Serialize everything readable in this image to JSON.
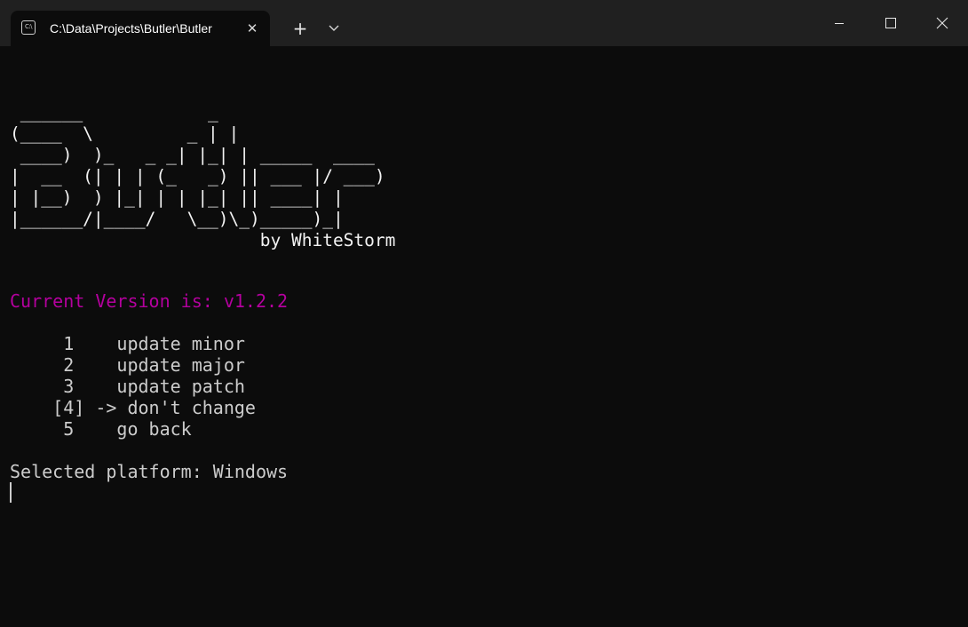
{
  "window": {
    "tab_title": "C:\\Data\\Projects\\Butler\\Butler",
    "tab_icon": "terminal-icon",
    "icons": {
      "tab_close": "close-icon",
      "new_tab": "plus-icon",
      "dropdown": "chevron-down-icon",
      "minimize": "minimize-icon",
      "maximize": "maximize-icon",
      "close": "close-icon"
    }
  },
  "terminal": {
    "banner": [
      " ______            _",
      "(____  \\         _ | |",
      " ____)  )_   _ _| |_| | _____  ____",
      "|  __  (| | | (_   _) || ___ |/ ___)",
      "| |__)  ) |_| | | |_| || ____| |",
      "|______/|____/   \\__)\\_)_____)_|",
      "                        by WhiteStorm"
    ],
    "version_line": "Current Version is: v1.2.2",
    "menu": [
      "     1    update minor",
      "     2    update major",
      "     3    update patch",
      "    [4] -> don't change",
      "     5    go back"
    ],
    "platform_line": "Selected platform: Windows"
  },
  "colors": {
    "background": "#0c0c0c",
    "titlebar": "#202020",
    "text": "#cccccc",
    "version_text": "#b4009e"
  }
}
